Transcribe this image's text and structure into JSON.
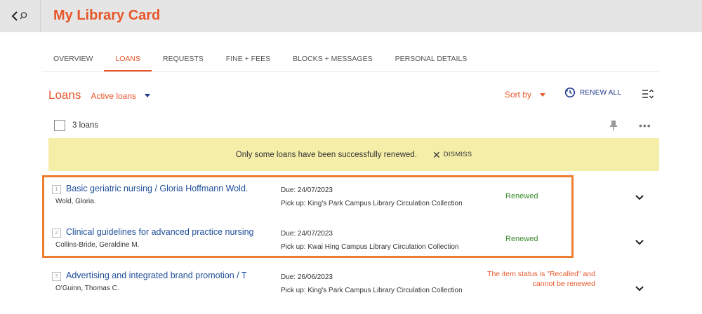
{
  "header": {
    "title": "My Library Card"
  },
  "tabs": [
    "OVERVIEW",
    "LOANS",
    "REQUESTS",
    "FINE + FEES",
    "BLOCKS + MESSAGES",
    "PERSONAL DETAILS"
  ],
  "loans": {
    "heading": "Loans",
    "filter": "Active loans",
    "sort_label": "Sort by",
    "renew_all": "RENEW ALL",
    "count": "3 loans"
  },
  "banner": {
    "message": "Only some loans have been successfully renewed.",
    "dismiss": "DISMISS"
  },
  "items": [
    {
      "num": "1",
      "title": "Basic geriatric nursing / Gloria Hoffmann Wold.",
      "author": "Wold, Gloria.",
      "due": "Due: 24/07/2023",
      "pickup": "Pick up: King's Park Campus Library Circulation Collection",
      "status": "Renewed"
    },
    {
      "num": "2",
      "title": "Clinical guidelines for advanced practice nursing",
      "author": "Collins-Bride, Geraldine M.",
      "due": "Due: 24/07/2023",
      "pickup": "Pick up: Kwai Hing Campus Library Circulation Collection",
      "status": "Renewed"
    },
    {
      "num": "3",
      "title": "Advertising and integrated brand promotion / T",
      "author": "O'Guinn, Thomas C.",
      "due": "Due: 26/06/2023",
      "pickup": "Pick up: King's Park Campus Library Circulation Collection",
      "status": "The item status is \"Recalled\" and cannot be renewed"
    }
  ],
  "colors": {
    "accent": "#e8562a",
    "link": "#1f4e9a",
    "success": "#3c8c2f",
    "banner_bg": "#f5eea8",
    "highlight_border": "#ed7d31"
  },
  "icons": [
    "back-search-icon",
    "renew-icon",
    "sort-list-icon",
    "pin-icon",
    "more-icon",
    "close-icon",
    "chevron-down-icon"
  ]
}
